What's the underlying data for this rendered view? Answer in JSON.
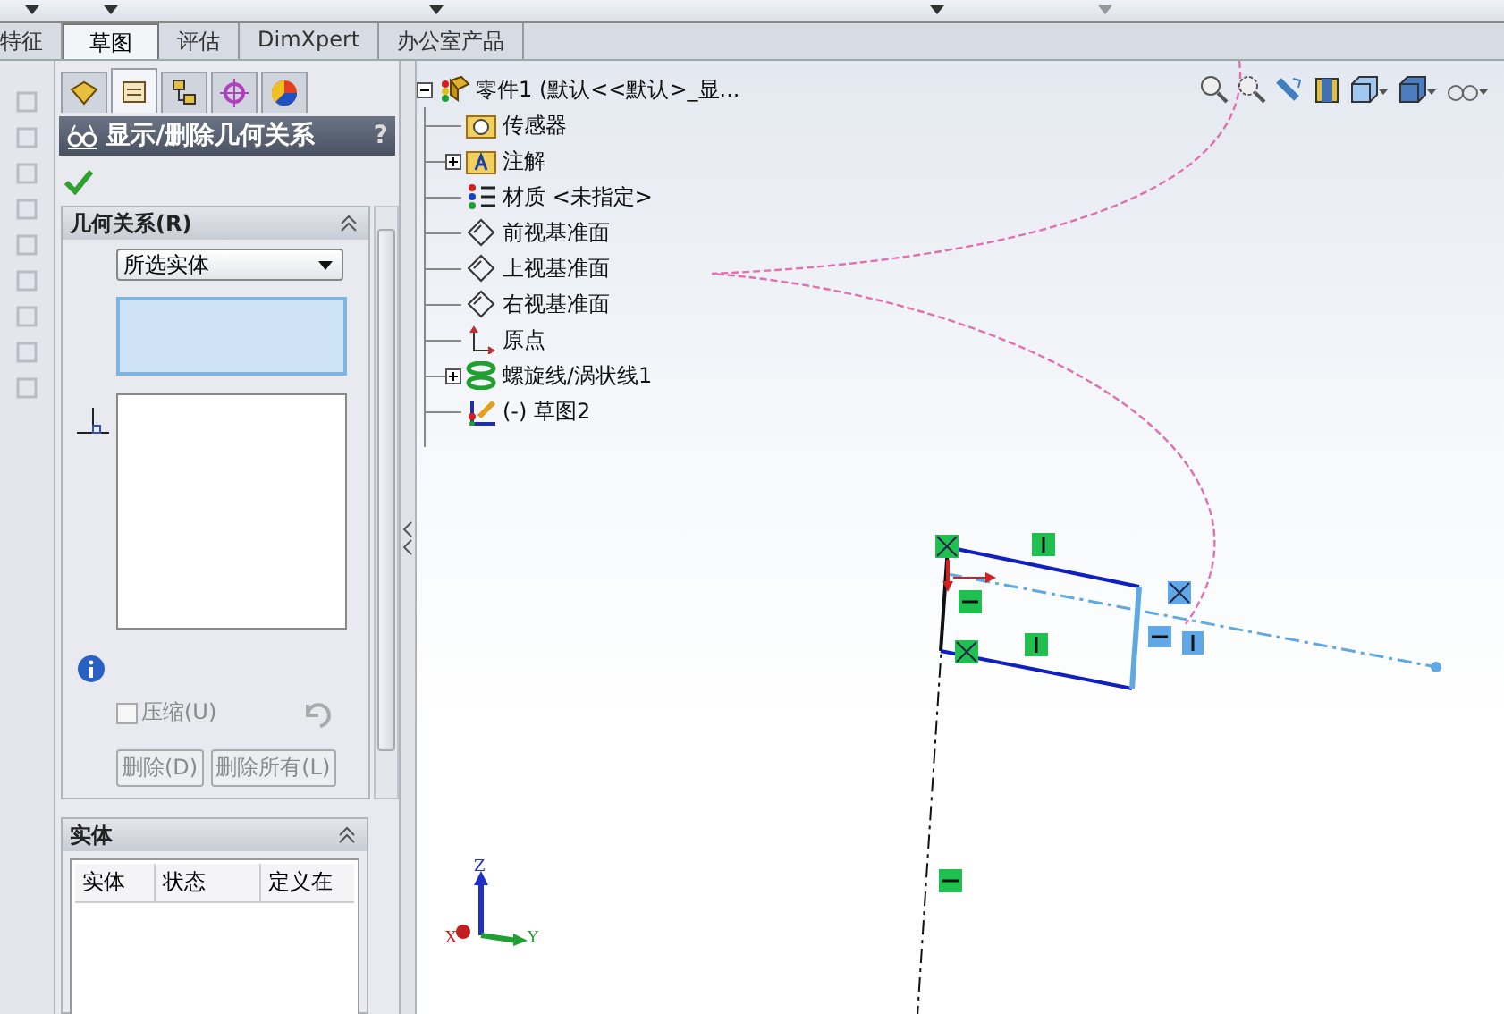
{
  "tabs": [
    {
      "label": "特征",
      "selected": false
    },
    {
      "label": "草图",
      "selected": true
    },
    {
      "label": "评估",
      "selected": false
    },
    {
      "label": "DimXpert",
      "selected": false
    },
    {
      "label": "办公室产品",
      "selected": false
    }
  ],
  "panel_tabs": [
    {
      "kind": "feature",
      "selected": false
    },
    {
      "kind": "property",
      "selected": true
    },
    {
      "kind": "config",
      "selected": false
    },
    {
      "kind": "dimxpert",
      "selected": false
    },
    {
      "kind": "display",
      "selected": false
    }
  ],
  "panel": {
    "title": "显示/删除几何关系",
    "help": "?"
  },
  "relations": {
    "title": "几何关系(R)",
    "filter": "所选实体",
    "suppress": {
      "label": "压缩(U)",
      "checked": false,
      "disabled": true
    },
    "buttons": [
      {
        "label": "删除(D)",
        "disabled": true
      },
      {
        "label": "删除所有(L)",
        "disabled": true
      }
    ]
  },
  "entities": {
    "title": "实体",
    "columns": [
      "实体",
      "状态",
      "定义在"
    ]
  },
  "tree": {
    "label": "零件1  (默认<<默认>_显...",
    "kind": "part",
    "expanded": true,
    "children": [
      {
        "label": "传感器",
        "kind": "sensor"
      },
      {
        "label": "注解",
        "kind": "annotation",
        "expanded": false
      },
      {
        "label": "材质 <未指定>",
        "kind": "material"
      },
      {
        "label": "前视基准面",
        "kind": "plane"
      },
      {
        "label": "上视基准面",
        "kind": "plane"
      },
      {
        "label": "右视基准面",
        "kind": "plane"
      },
      {
        "label": "原点",
        "kind": "origin"
      },
      {
        "label": "螺旋线/涡状线1",
        "kind": "helix",
        "expanded": false
      },
      {
        "label": "(-) 草图2",
        "kind": "sketch"
      }
    ]
  },
  "triad": {
    "x": "X",
    "y": "Y",
    "z": "Z"
  }
}
